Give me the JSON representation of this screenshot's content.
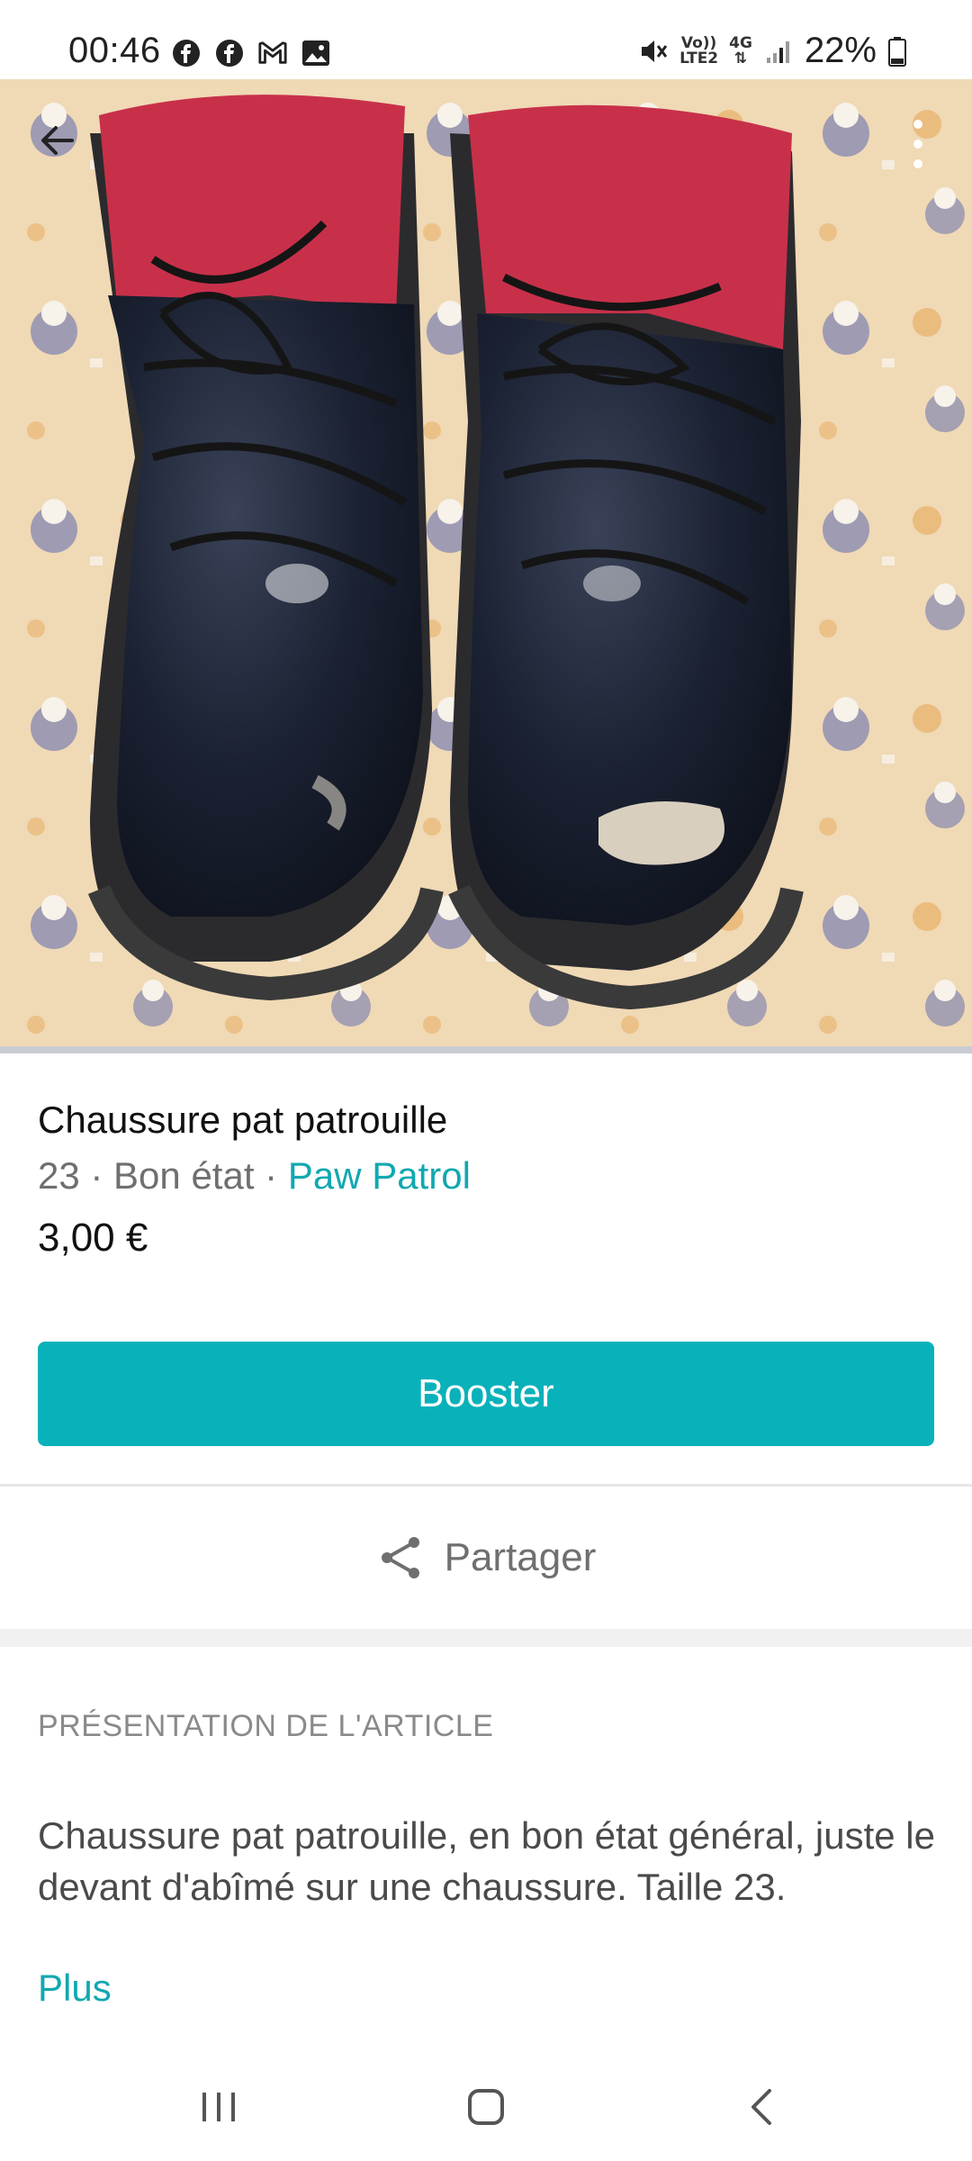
{
  "status_bar": {
    "time": "00:46",
    "battery": "22%",
    "network_top": "Vo))",
    "network_bottom": "LTE2",
    "network_type": "4G",
    "icons": [
      "facebook-icon",
      "facebook-icon",
      "gmail-icon",
      "gallery-icon",
      "mute-icon",
      "signal-icon",
      "battery-icon"
    ]
  },
  "item": {
    "title": "Chaussure pat patrouille",
    "size": "23",
    "separator": " · ",
    "condition": "Bon état",
    "brand": "Paw Patrol",
    "price": "3,00 €"
  },
  "actions": {
    "boost_label": "Booster",
    "share_label": "Partager"
  },
  "description": {
    "heading": "PRÉSENTATION DE L'ARTICLE",
    "text": "Chaussure pat patrouille, en bon état général, juste le devant d'abîmé sur une chaussure. Taille 23.",
    "more_label": "Plus"
  },
  "colors": {
    "accent": "#09b1ba",
    "link": "#11a8b0"
  }
}
